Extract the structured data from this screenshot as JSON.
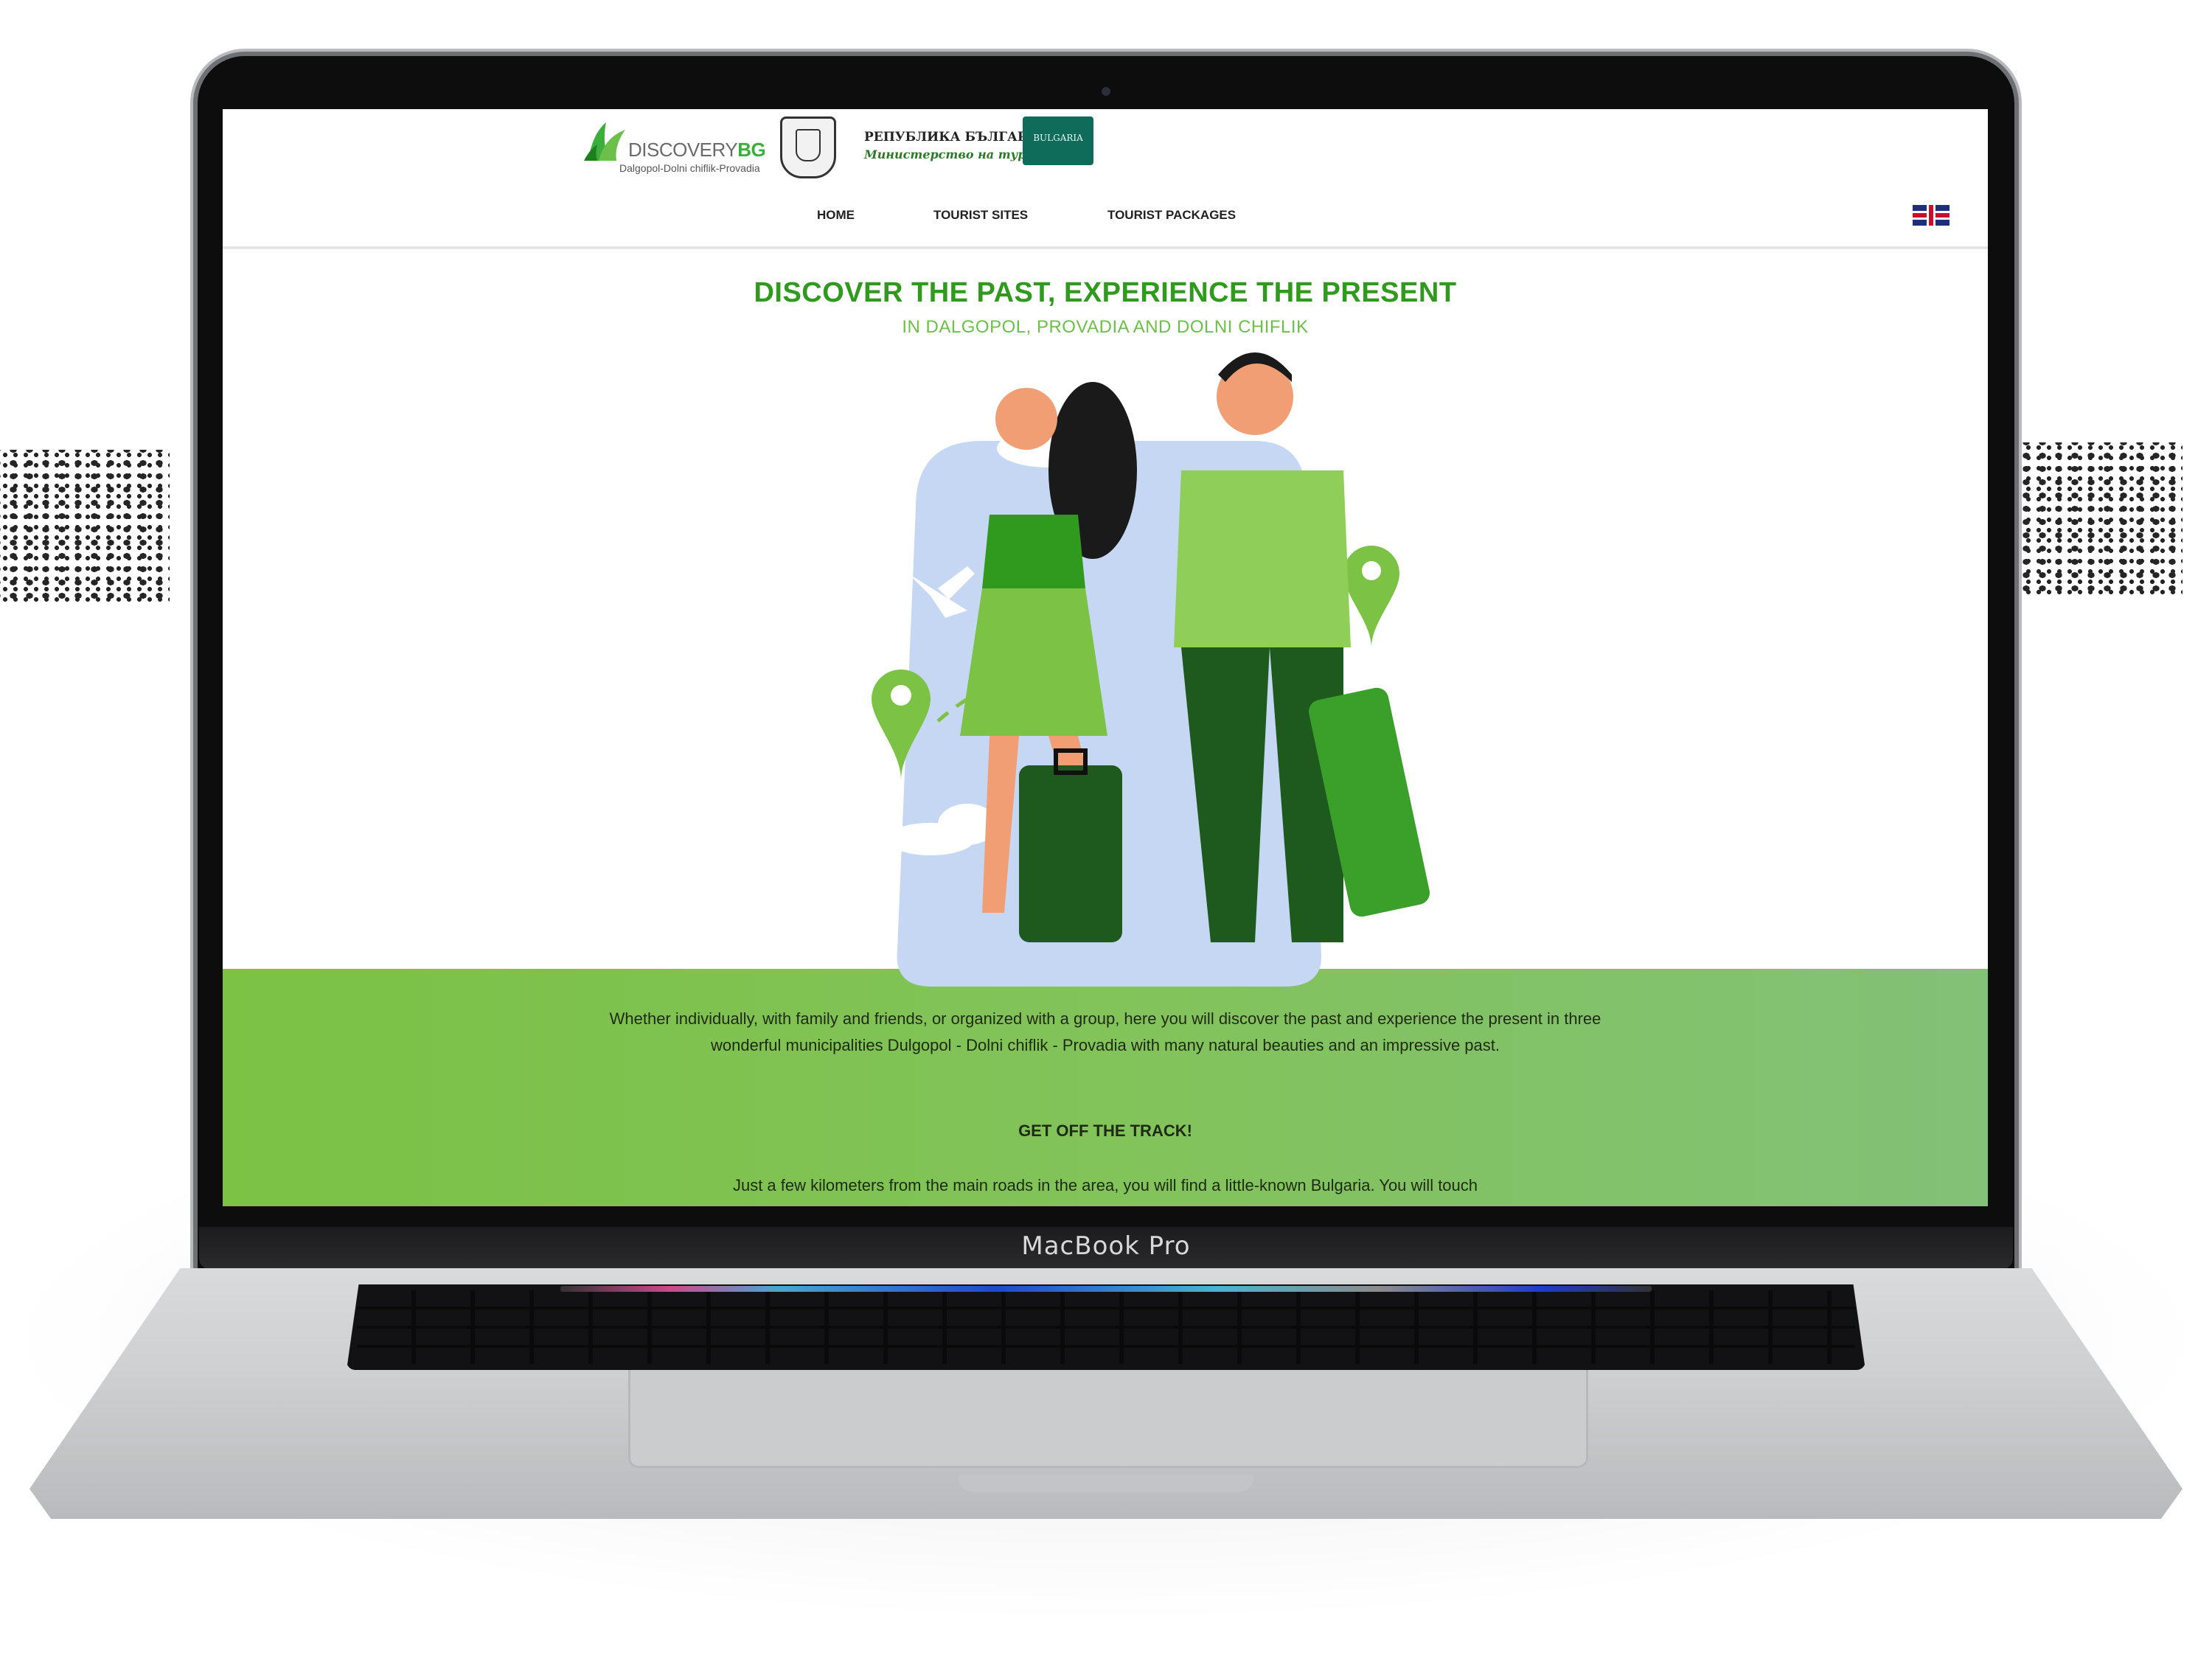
{
  "device": {
    "brand_label": "MacBook Pro"
  },
  "header": {
    "logo": {
      "word_prefix": "DISCOVERY",
      "word_suffix": "BG",
      "subtitle": "Dalgopol-Dolni chiflik-Provadia"
    },
    "ministry": {
      "line1": "РЕПУБЛИКА БЪЛГАРИЯ",
      "line2": "Министерство на туризма"
    },
    "badge_text": "BULGARIA",
    "language_flag": "uk-flag-icon"
  },
  "nav": {
    "items": [
      {
        "label": "HOME"
      },
      {
        "label": "TOURIST SITES"
      },
      {
        "label": "TOURIST PACKAGES"
      }
    ]
  },
  "hero": {
    "title": "DISCOVER THE PAST, EXPERIENCE THE PRESENT",
    "subtitle": "IN DALGOPOL, PROVADIA AND DOLNI CHIFLIK"
  },
  "content": {
    "intro": "Whether individually, with family and friends, or organized with a group, here you will discover the past and experience the present in three wonderful municipalities Dulgopol - Dolni chiflik - Provadia with many natural beauties and an impressive past.",
    "heading": "GET OFF THE TRACK!",
    "paragraph_line1": "Just a few kilometers from the main roads in the area, you will find a little-known Bulgaria. You will touch"
  },
  "colors": {
    "brand_green": "#2f9a1d",
    "light_green": "#6cc04a",
    "band_green": "#7bc245",
    "dark_green": "#1e5a1e"
  }
}
